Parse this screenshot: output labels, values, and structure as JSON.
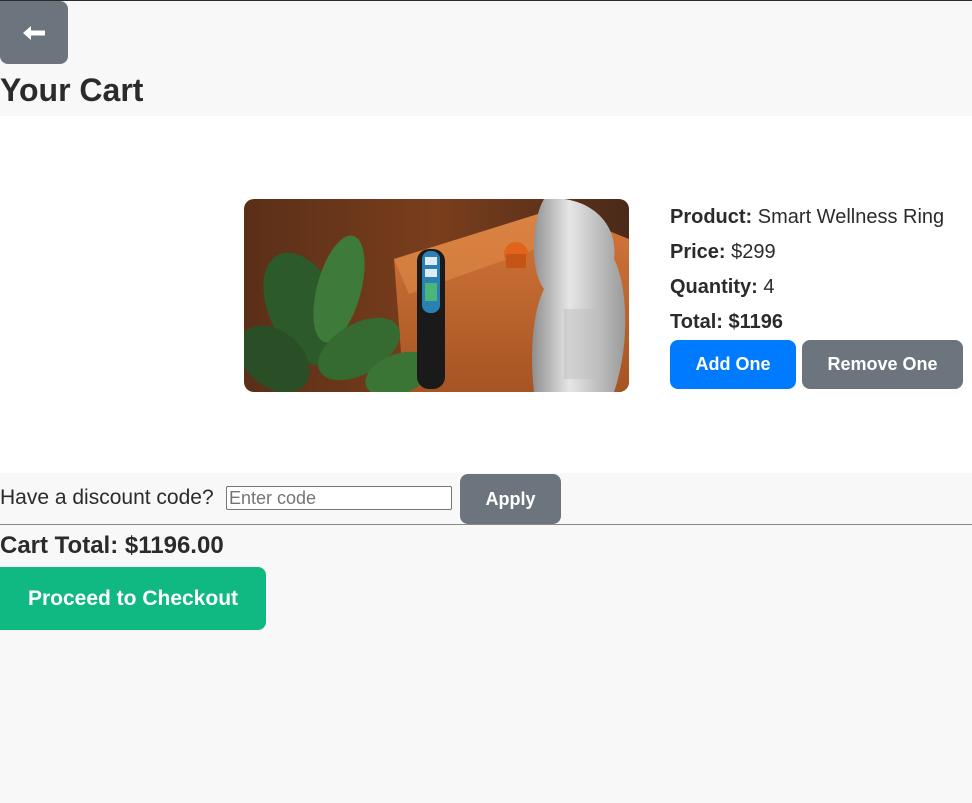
{
  "header": {
    "back_icon": "left-arrow-icon",
    "back_glyph": "🡐",
    "title": "Your Cart"
  },
  "item": {
    "image_description": "product-photo",
    "product_label": "Product:",
    "product_value": "Smart Wellness Ring",
    "price_label": "Price:",
    "price_value": "$299",
    "quantity_label": "Quantity:",
    "quantity_value": "4",
    "total_label": "Total:",
    "total_value": "$1196",
    "add_label": "Add One",
    "remove_label": "Remove One"
  },
  "discount": {
    "label": "Have a discount code?",
    "placeholder": "Enter code",
    "value": "",
    "apply_label": "Apply"
  },
  "summary": {
    "cart_total": "Cart Total: $1196.00",
    "checkout_label": "Proceed to Checkout"
  },
  "colors": {
    "primary": "#007bff",
    "secondary": "#6c757d",
    "success": "#10b981",
    "background": "#f8f8f8"
  }
}
